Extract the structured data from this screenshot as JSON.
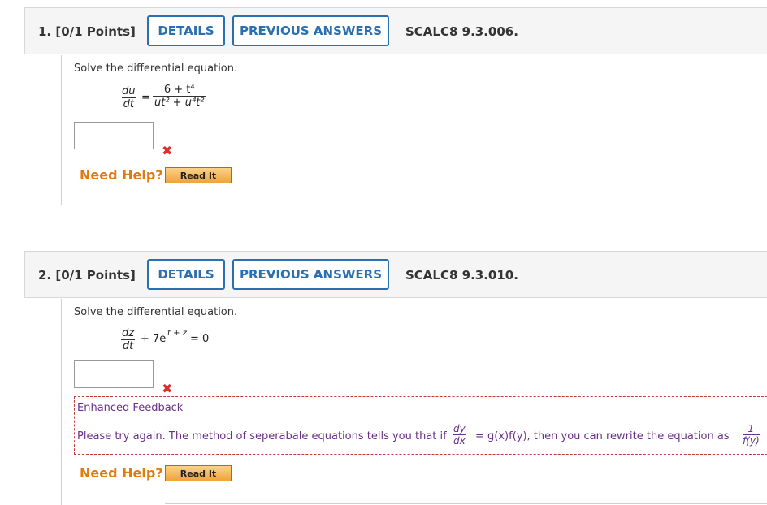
{
  "q1": {
    "number": "1. [0/1 Points]",
    "details_label": "DETAILS",
    "prev_label": "PREVIOUS ANSWERS",
    "code": "SCALC8 9.3.006.",
    "prompt": "Solve the differential equation.",
    "lhs_num": "du",
    "lhs_den": "dt",
    "eq": "=",
    "rhs_num": "6 + t⁴",
    "rhs_den": "ut² + u⁴t²",
    "answer": "",
    "help_label": "Need Help?",
    "read_label": "Read It"
  },
  "q2": {
    "number": "2. [0/1 Points]",
    "details_label": "DETAILS",
    "prev_label": "PREVIOUS ANSWERS",
    "code": "SCALC8 9.3.010.",
    "prompt": "Solve the differential equation.",
    "lhs_num": "dz",
    "lhs_den": "dt",
    "rest": "+ 7e",
    "exp": "t + z",
    "tail": "= 0",
    "answer": "",
    "feedback_title": "Enhanced Feedback",
    "feedback_text_a": "Please try again. The method of seperabale equations tells you that if",
    "fb_num": "dy",
    "fb_den": "dx",
    "feedback_text_b": "= g(x)f(y),  then you can rewrite the equation as",
    "fb2_num": "1",
    "fb2_den": "f(y)",
    "help_label": "Need Help?",
    "read_label": "Read It"
  },
  "colors": {
    "accent": "#2a6fb0",
    "help": "#e07b14",
    "error": "#d9302c",
    "feedback": "#6b2f8a"
  }
}
